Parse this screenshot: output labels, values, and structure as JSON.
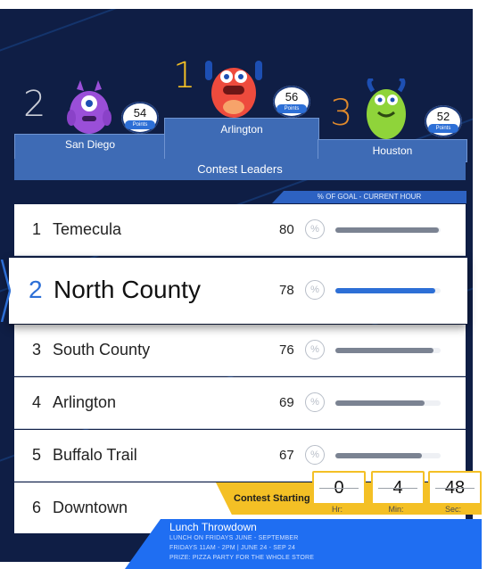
{
  "podium": [
    {
      "rank": "2",
      "city": "San Diego",
      "points": "54",
      "points_label": "Points"
    },
    {
      "rank": "1",
      "city": "Arlington",
      "points": "56",
      "points_label": "Points"
    },
    {
      "rank": "3",
      "city": "Houston",
      "points": "52",
      "points_label": "Points"
    }
  ],
  "contest_leaders": "Contest Leaders",
  "goal_header": "% OF GOAL - CURRENT HOUR",
  "leaderboard": [
    {
      "rank": "1",
      "name": "Temecula",
      "value": "80",
      "percent_symbol": "%",
      "progress": 0.98
    },
    {
      "rank": "2",
      "name": "North County",
      "value": "78",
      "percent_symbol": "%",
      "progress": 0.95
    },
    {
      "rank": "3",
      "name": "South County",
      "value": "76",
      "percent_symbol": "%",
      "progress": 0.93
    },
    {
      "rank": "4",
      "name": "Arlington",
      "value": "69",
      "percent_symbol": "%",
      "progress": 0.85
    },
    {
      "rank": "5",
      "name": "Buffalo Trail",
      "value": "67",
      "percent_symbol": "%",
      "progress": 0.82
    },
    {
      "rank": "6",
      "name": "Downtown",
      "value": "",
      "percent_symbol": "",
      "progress": null
    }
  ],
  "timer": {
    "label": "Contest Starting",
    "hours": "0",
    "minutes": "4",
    "seconds": "48",
    "hours_label": "Hr:",
    "minutes_label": "Min:",
    "seconds_label": "Sec:"
  },
  "promo": {
    "title": "Lunch Throwdown",
    "line1": "LUNCH ON FRIDAYS JUNE - SEPTEMBER",
    "line2": "FRIDAYS 11AM - 2PM | JUNE 24 - SEP 24",
    "line3": "PRIZE: PIZZA PARTY FOR THE WHOLE STORE"
  },
  "colors": {
    "background": "#0f1e45",
    "accent_blue": "#2d6fd6",
    "rank1": "#f4c025",
    "rank2": "#c9ccd6",
    "rank3": "#e08a2c",
    "timer_yellow": "#f4c025"
  }
}
